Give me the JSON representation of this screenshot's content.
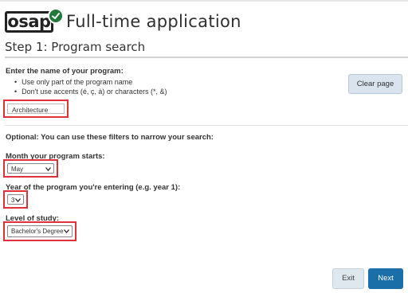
{
  "brand": {
    "logo_text": "osap",
    "title": "Full-time application"
  },
  "step": {
    "title": "Step 1: Program search"
  },
  "program": {
    "label": "Enter the name of your program:",
    "hints": [
      "Use only part of the program name",
      "Don't use accents (é, ç, à) or characters (*, &)"
    ],
    "value": "Architecture"
  },
  "actions": {
    "clear": "Clear page",
    "exit": "Exit",
    "next": "Next"
  },
  "filters": {
    "intro": "Optional: You can use these filters to narrow your search:",
    "month": {
      "label": "Month your program starts:",
      "value": "May"
    },
    "year": {
      "label": "Year of the program you're entering (e.g. year 1):",
      "value": "3"
    },
    "level": {
      "label": "Level of study:",
      "value": "Bachelor's Degree"
    }
  },
  "colors": {
    "highlight": "#e0313b",
    "primary": "#1a6fa8",
    "logo_check": "#1f7a3a"
  },
  "icons": {
    "logo_badge": "check-icon",
    "dropdown": "chevron-down-icon"
  }
}
